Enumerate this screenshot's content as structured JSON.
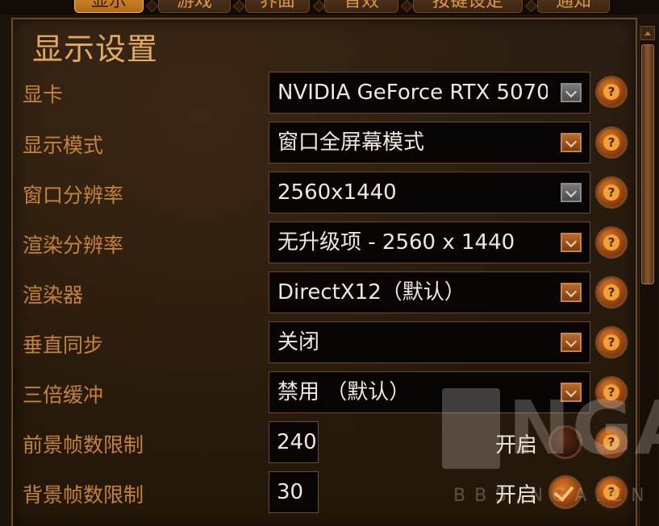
{
  "tabs": [
    {
      "label": "显示"
    },
    {
      "label": "游戏"
    },
    {
      "label": "界面"
    },
    {
      "label": "音效"
    },
    {
      "label": "按键设定"
    },
    {
      "label": "通知"
    }
  ],
  "page_title": "显示设置",
  "rows": [
    {
      "label": "显卡",
      "value": "NVIDIA GeForce RTX 5070",
      "enabled": false
    },
    {
      "label": "显示模式",
      "value": "窗口全屏幕模式",
      "enabled": true
    },
    {
      "label": "窗口分辨率",
      "value": "2560x1440",
      "enabled": false
    },
    {
      "label": "渲染分辨率",
      "value": "无升级项 - 2560 x 1440",
      "enabled": true
    },
    {
      "label": "渲染器",
      "value": "DirectX12（默认）",
      "enabled": true
    },
    {
      "label": "垂直同步",
      "value": "关闭",
      "enabled": true
    },
    {
      "label": "三倍缓冲",
      "value": "禁用 （默认）",
      "enabled": true
    }
  ],
  "fps_rows": [
    {
      "label": "前景帧数限制",
      "value": "240",
      "toggle_label": "开启",
      "checked": false
    },
    {
      "label": "背景帧数限制",
      "value": "30",
      "toggle_label": "开启",
      "checked": true
    }
  ],
  "help_icon": "?",
  "watermark": {
    "logo": "NGA",
    "site": "BBS.NGA.CN"
  },
  "colors": {
    "accent": "#d8902e",
    "label": "#c5823d",
    "value": "#f1e8dc"
  }
}
